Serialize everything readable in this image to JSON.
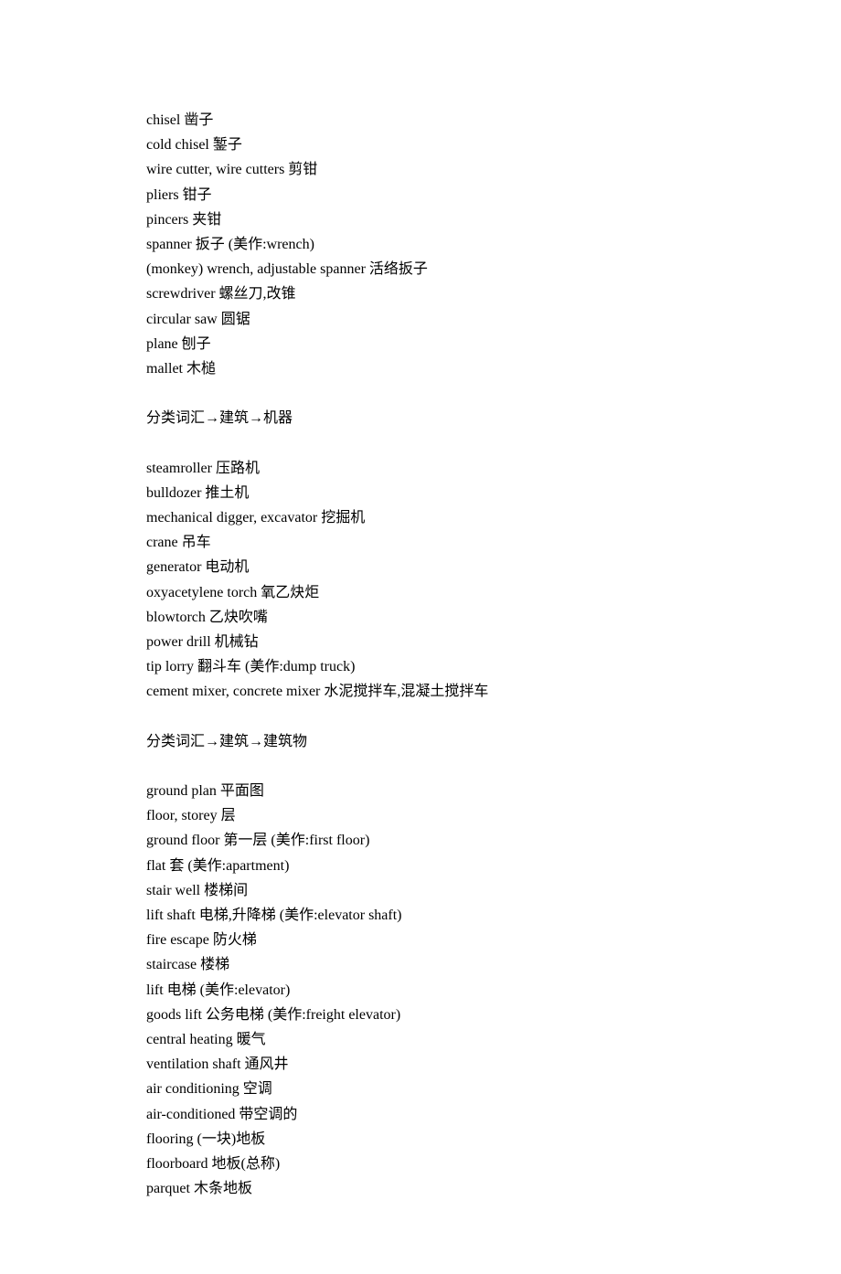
{
  "section1": {
    "items": [
      "chisel 凿子",
      "cold chisel 錾子",
      "wire cutter, wire cutters 剪钳",
      "pliers 钳子",
      "pincers 夹钳",
      "spanner 扳子 (美作:wrench)",
      "(monkey) wrench, adjustable spanner 活络扳子",
      "screwdriver 螺丝刀,改锥",
      "circular saw 圆锯",
      "plane 刨子",
      "mallet 木槌"
    ]
  },
  "section2": {
    "heading": "分类词汇→建筑→机器",
    "items": [
      "steamroller 压路机",
      "bulldozer 推土机",
      "mechanical digger, excavator 挖掘机",
      "crane 吊车",
      "generator 电动机",
      "oxyacetylene torch 氧乙炔炬",
      "blowtorch 乙炔吹嘴",
      "power drill 机械钻",
      "tip lorry 翻斗车 (美作:dump truck)",
      "cement mixer, concrete mixer 水泥搅拌车,混凝土搅拌车"
    ]
  },
  "section3": {
    "heading": "分类词汇→建筑→建筑物",
    "items": [
      "ground plan 平面图",
      "floor, storey 层",
      "ground floor 第一层 (美作:first floor)",
      "flat 套 (美作:apartment)",
      "stair well 楼梯间",
      "lift shaft 电梯,升降梯 (美作:elevator shaft)",
      "fire escape 防火梯",
      "staircase 楼梯",
      "lift 电梯 (美作:elevator)",
      "goods lift 公务电梯 (美作:freight elevator)",
      "central heating 暖气",
      "ventilation shaft 通风井",
      "air conditioning 空调",
      "air-conditioned 带空调的",
      "flooring (一块)地板",
      "floorboard 地板(总称)",
      "parquet 木条地板"
    ]
  }
}
